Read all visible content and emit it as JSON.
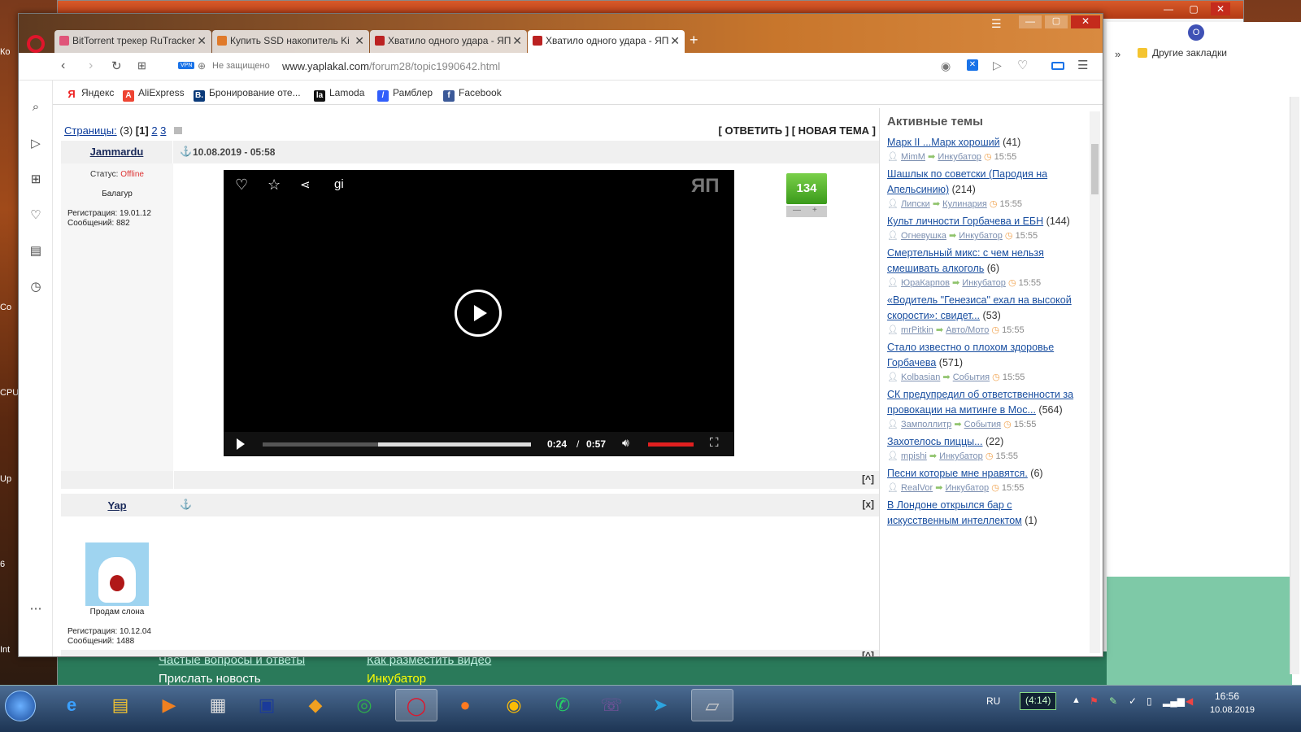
{
  "desktop": {
    "icons": [
      "Ко",
      "Co",
      "CPU",
      "Up",
      "6",
      "Int"
    ]
  },
  "back_window": {
    "bookmarks_overflow": "»",
    "other_bookmarks": "Другие закладки",
    "profile_letter": "O",
    "footer_links": [
      "Частые вопросы и ответы",
      "Как разместить видео",
      "Прислать новость",
      "Инкубатор"
    ]
  },
  "browser": {
    "tabs": [
      {
        "label": "BitTorrent трекер RuTracker",
        "icon_color": "#e0557a"
      },
      {
        "label": "Купить SSD накопитель Ki",
        "icon_color": "#e07a2a"
      },
      {
        "label": "Хватило одного удара - ЯП",
        "icon_color": "#b22"
      },
      {
        "label": "Хватило одного удара - ЯП",
        "icon_color": "#b22"
      }
    ],
    "new_tab": "+",
    "security": "Не защищено",
    "vpn": "VPN",
    "url_domain": "www.yaplakal.com",
    "url_path": "/forum28/topic1990642.html",
    "bookmarks": [
      {
        "label": "Яндекс",
        "icon": "Я",
        "color": "#e22"
      },
      {
        "label": "AliExpress",
        "icon": "A",
        "color": "#e43"
      },
      {
        "label": "Бронирование оте...",
        "icon": "B.",
        "color": "#0a3a7a"
      },
      {
        "label": "Lamoda",
        "icon": "la",
        "color": "#111"
      },
      {
        "label": "Рамблер",
        "icon": "/",
        "color": "#315efb"
      },
      {
        "label": "Facebook",
        "icon": "f",
        "color": "#3b5998"
      }
    ]
  },
  "forum": {
    "pages_label": "Страницы:",
    "pages_count": "(3)",
    "page_current": "[1]",
    "page_2": "2",
    "page_3": "3",
    "actions": "[ ОТВЕТИТЬ ] [ НОВАЯ ТЕМА ]",
    "post1": {
      "author": "Jammardu",
      "date": "10.08.2019 - 05:58",
      "status_label": "Статус:",
      "status_value": "Offline",
      "rank": "Балагур",
      "registered": "Регистрация: 19.01.12",
      "messages": "Сообщений: 882",
      "rating": "134",
      "rating_minus": "—",
      "rating_plus": "+"
    },
    "post2": {
      "author": "Yap",
      "close": "[x]",
      "caption": "Продам слона",
      "registered": "Регистрация: 10.12.04",
      "messages": "Сообщений: 1488"
    },
    "to_top": "[^]",
    "video": {
      "gif_label": "gi",
      "logo": "ЯП",
      "time_current": "0:24",
      "time_sep": "/",
      "time_total": "0:57",
      "progress": 0.43,
      "volume": 1.0
    }
  },
  "active_topics": {
    "title": "Активные темы",
    "items": [
      {
        "title": "Марк II ...Марк хороший",
        "count": "(41)",
        "user": "MimM",
        "section": "Инкубатор",
        "time": "15:55"
      },
      {
        "title": "Шашлык по советски (Пародия на Апельсинию)",
        "count": "(214)",
        "user": "Липски",
        "section": "Кулинария",
        "time": "15:55"
      },
      {
        "title": "Культ личности Горбачева и ЕБН",
        "count": "(144)",
        "user": "Огневушка",
        "section": "Инкубатор",
        "time": "15:55"
      },
      {
        "title": "Смертельный микс: с чем нельзя смешивать алкоголь",
        "count": "(6)",
        "user": "ЮраКарпов",
        "section": "Инкубатор",
        "time": "15:55"
      },
      {
        "title": "«Водитель \"Генезиса\" ехал на высокой скорости»: свидет...",
        "count": "(53)",
        "user": "mrPitkin",
        "section": "Авто/Мото",
        "time": "15:55"
      },
      {
        "title": "Стало известно о плохом здоровье Горбачева",
        "count": "(571)",
        "user": "Kolbasian",
        "section": "События",
        "time": "15:55"
      },
      {
        "title": "СК предупредил об ответственности за провокации на митинге в Мос...",
        "count": "(564)",
        "user": "Замполлитр",
        "section": "События",
        "time": "15:55"
      },
      {
        "title": "Захотелось пиццы...",
        "count": "(22)",
        "user": "mpishi",
        "section": "Инкубатор",
        "time": "15:55"
      },
      {
        "title": "Песни которые мне нравятся.",
        "count": "(6)",
        "user": "RealVor",
        "section": "Инкубатор",
        "time": "15:55"
      },
      {
        "title": "В Лондоне открылся бар с искусственным интеллектом",
        "count": "(1)",
        "user": "",
        "section": "",
        "time": ""
      }
    ]
  },
  "taskbar": {
    "language": "RU",
    "battery": "(4:14)",
    "time": "16:56",
    "date": "10.08.2019"
  }
}
